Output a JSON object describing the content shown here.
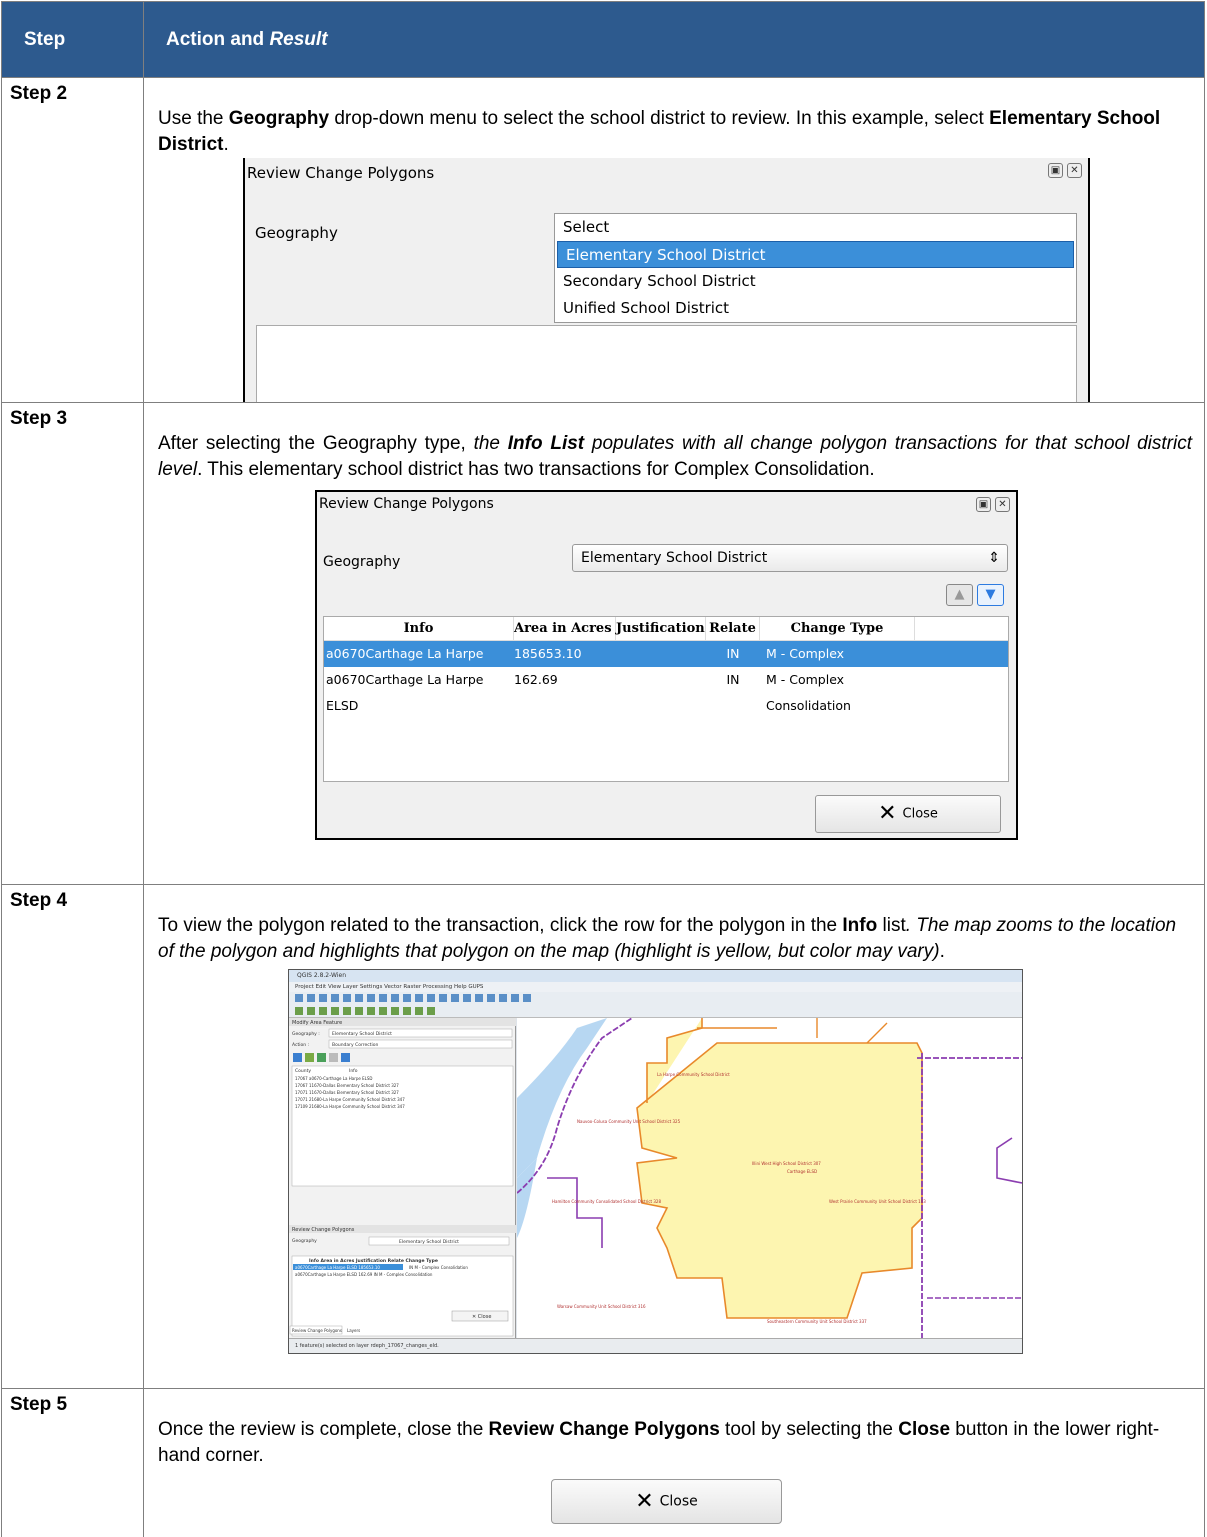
{
  "header": {
    "col1": "Step",
    "col2_plain": "Action and ",
    "col2_italic": "Result"
  },
  "rows": [
    {
      "step": "Step 2",
      "text": {
        "a": "Use the ",
        "b": "Geography",
        "c": " drop-down menu to select the school district to review. In this example, select ",
        "d": "Elementary School District",
        "e": "."
      },
      "screenshot": {
        "title": "Review Change Polygons",
        "geo_label": "Geography",
        "options": [
          "Select",
          "Elementary School District",
          "Secondary School District",
          "Unified School District"
        ],
        "selected_index": 1
      }
    },
    {
      "step": "Step 3",
      "text": {
        "a": "After selecting the Geography type, ",
        "b": "the ",
        "c": "Info List",
        "d": " populates with all change polygon transactions for that school district level",
        "e": ". This elementary school district has two transactions for Complex Consolidation."
      },
      "screenshot": {
        "title": "Review Change Polygons",
        "geo_label": "Geography",
        "geo_value": "Elementary School District",
        "columns": [
          "Info",
          "Area in Acres",
          "Justification",
          "Relate",
          "Change Type"
        ],
        "table_rows": [
          {
            "info": "a0670Carthage La Harpe ELSD",
            "area": "185653.10",
            "just": "",
            "relate": "IN",
            "change": "M - Complex Consolidation"
          },
          {
            "info": "a0670Carthage La Harpe ELSD",
            "area": "162.69",
            "just": "",
            "relate": "IN",
            "change": "M - Complex Consolidation"
          }
        ],
        "close_label": "Close"
      }
    },
    {
      "step": "Step 4",
      "text": {
        "a": "To view the polygon related to the transaction, click the row for the polygon in the ",
        "b": "Info",
        "c": " list",
        "d": ". The map zooms to the location of the polygon and highlights that polygon on the map (highlight is yellow, but color may vary)",
        "e": "."
      },
      "screenshot": {
        "title": "QGIS 2.8.2-Wien",
        "menu": "Project  Edit  View  Layer  Settings  Vector  Raster  Processing  Help  GUPS",
        "panel_title": "Modify Area Feature",
        "geography": "Elementary School District",
        "action": "Boundary Correction",
        "county_items": [
          "17067  a0670-Carthage La Harpe ELSD",
          "17067  11670-Dallas Elementary School District 327",
          "17071  11670-Dallas Elementary School District 327",
          "17071  21680-La Harpe Community School District 347",
          "17109  21680-La Harpe Community School District 347"
        ],
        "review_title": "Review Change Polygons",
        "status": "1 feature(s) selected on layer rdeph_17067_changes_eld.",
        "tabs": [
          "Review Change Polygons",
          "Layers"
        ],
        "map_labels": [
          "Carthage ELSD",
          "La Harpe Community School District",
          "Nauvoo-Colusa Community Unit School District 325",
          "Warsaw Community Unit School District 316",
          "Southeastern Community Unit School District 337",
          "Illini West High School District 307",
          "West Prairie Community Unit School District 103",
          "Hamilton Community Consolidated School District 328"
        ],
        "colors": {
          "highlight": "#fdf5b0",
          "boundary_orange": "#e8892b",
          "boundary_purple": "#8b3db0",
          "water": "#b7d7f2"
        }
      }
    },
    {
      "step": "Step 5",
      "text": {
        "a": "Once the review is complete, close the ",
        "b": "Review Change Polygons",
        "c": " tool by selecting the ",
        "d": "Close",
        "e": " button in the lower right-hand corner."
      },
      "close_label": "Close"
    }
  ]
}
